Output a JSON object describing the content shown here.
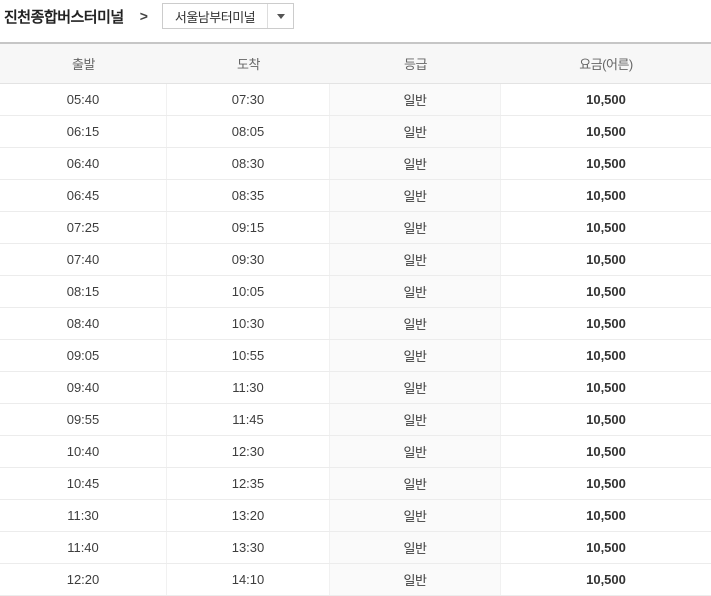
{
  "breadcrumb": {
    "origin_terminal": "진천종합버스터미널",
    "separator": ">",
    "destination_select": {
      "value": "서울남부터미널",
      "dropdown_icon": "triangle-down"
    }
  },
  "timetable": {
    "columns": [
      "출발",
      "도착",
      "등급",
      "요금(어른)"
    ],
    "rows": [
      [
        "05:40",
        "07:30",
        "일반",
        "10,500"
      ],
      [
        "06:15",
        "08:05",
        "일반",
        "10,500"
      ],
      [
        "06:40",
        "08:30",
        "일반",
        "10,500"
      ],
      [
        "06:45",
        "08:35",
        "일반",
        "10,500"
      ],
      [
        "07:25",
        "09:15",
        "일반",
        "10,500"
      ],
      [
        "07:40",
        "09:30",
        "일반",
        "10,500"
      ],
      [
        "08:15",
        "10:05",
        "일반",
        "10,500"
      ],
      [
        "08:40",
        "10:30",
        "일반",
        "10,500"
      ],
      [
        "09:05",
        "10:55",
        "일반",
        "10,500"
      ],
      [
        "09:40",
        "11:30",
        "일반",
        "10,500"
      ],
      [
        "09:55",
        "11:45",
        "일반",
        "10,500"
      ],
      [
        "10:40",
        "12:30",
        "일반",
        "10,500"
      ],
      [
        "10:45",
        "12:35",
        "일반",
        "10,500"
      ],
      [
        "11:30",
        "13:20",
        "일반",
        "10,500"
      ],
      [
        "11:40",
        "13:30",
        "일반",
        "10,500"
      ],
      [
        "12:20",
        "14:10",
        "일반",
        "10,500"
      ]
    ]
  },
  "colors": {
    "table_top_border": "#c6c6c6",
    "header_bg": "#f7f7f7",
    "grade_column_bg": "#fafafa",
    "row_divider": "#ececec",
    "fare_text": "#333333",
    "title_text": "#222222"
  }
}
